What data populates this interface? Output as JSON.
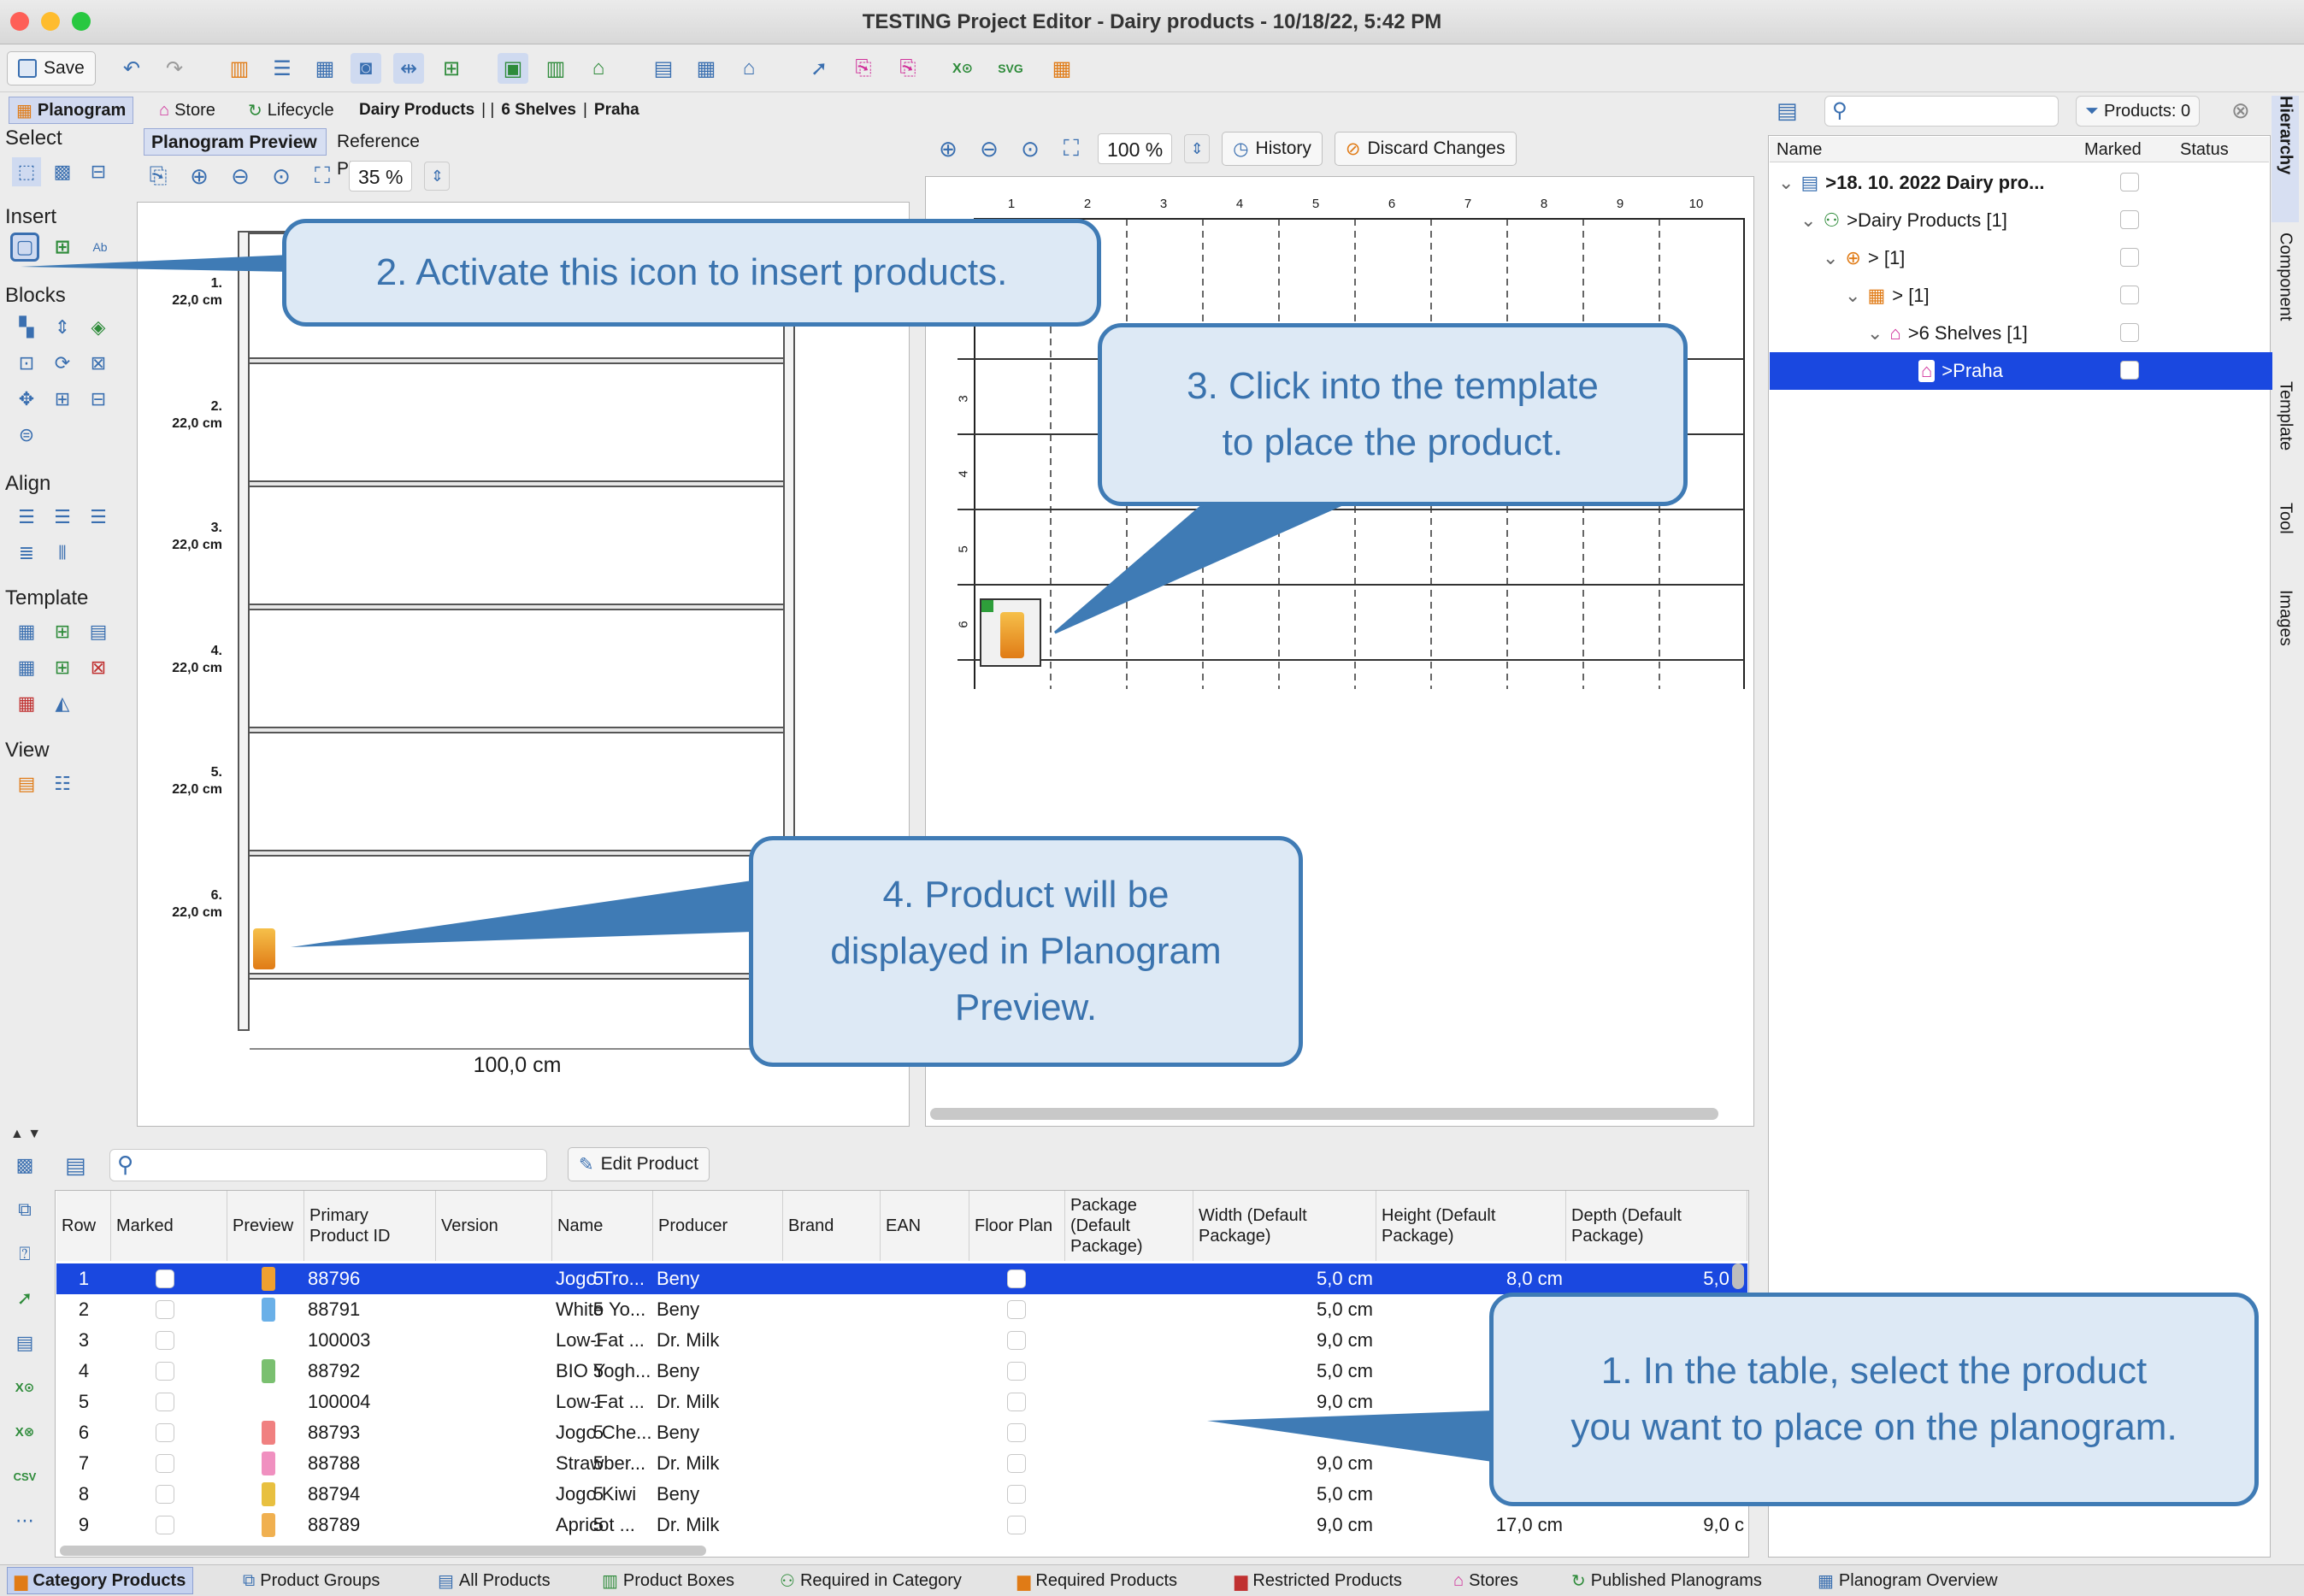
{
  "window": {
    "title": "TESTING Project Editor - Dairy products - 10/18/22, 5:42 PM"
  },
  "toolbar": {
    "save_label": "Save",
    "zoom_left": "35 %",
    "zoom_right": "100 %",
    "history_label": "History",
    "discard_label": "Discard Changes"
  },
  "context": {
    "tabs": [
      {
        "label": "Planogram"
      },
      {
        "label": "Store"
      },
      {
        "label": "Lifecycle"
      }
    ],
    "crumb_1": "Dairy Products",
    "crumb_sep": "| |",
    "crumb_2": "6 Shelves",
    "crumb_sep2": "|",
    "crumb_3": "Praha"
  },
  "palette": {
    "select": "Select",
    "insert": "Insert",
    "blocks": "Blocks",
    "align": "Align",
    "template": "Template",
    "view": "View"
  },
  "preview": {
    "tab_preview": "Planogram Preview",
    "tab_photos": "Reference Photos",
    "shelves": [
      {
        "n": "1.",
        "h": "22,0 cm"
      },
      {
        "n": "2.",
        "h": "22,0 cm"
      },
      {
        "n": "3.",
        "h": "22,0 cm"
      },
      {
        "n": "4.",
        "h": "22,0 cm"
      },
      {
        "n": "5.",
        "h": "22,0 cm"
      },
      {
        "n": "6.",
        "h": "22,0 cm"
      }
    ],
    "width_label": "100,0 cm"
  },
  "grid": {
    "cols": [
      "1",
      "2",
      "3",
      "4",
      "5",
      "6",
      "7",
      "8",
      "9",
      "10"
    ],
    "rows": [
      "2",
      "3",
      "4",
      "5",
      "6"
    ]
  },
  "hierarchy": {
    "products_label": "Products: 0",
    "col_name": "Name",
    "col_marked": "Marked",
    "col_status": "Status",
    "rows": [
      {
        "label": ">18. 10. 2022 Dairy pro..."
      },
      {
        "label": ">Dairy Products [1]"
      },
      {
        "label": "> [1]"
      },
      {
        "label": "> [1]"
      },
      {
        "label": ">6 Shelves [1]"
      },
      {
        "label": ">Praha"
      }
    ]
  },
  "side_tabs": {
    "hierarchy": "Hierarchy",
    "component": "Component",
    "template": "Template",
    "tool": "Tool",
    "images": "Images"
  },
  "table": {
    "edit_label": "Edit Product",
    "headers": {
      "row": "Row",
      "marked": "Marked",
      "preview": "Preview",
      "primary_1": "Primary",
      "primary_2": "Product ID",
      "version": "Version",
      "name": "Name",
      "producer": "Producer",
      "brand": "Brand",
      "ean": "EAN",
      "floor": "Floor Plan",
      "pkg_1": "Package",
      "pkg_2": "(Default",
      "pkg_3": "Package)",
      "w_1": "Width (Default",
      "w_2": "Package)",
      "h_1": "Height (Default",
      "h_2": "Package)",
      "d_1": "Depth (Default",
      "d_2": "Package)"
    },
    "rows": [
      {
        "row": "1",
        "pid": "88796",
        "ver": "5",
        "name": "Jogo Tro...",
        "prod": "Beny",
        "w": "5,0 cm",
        "h": "8,0 cm",
        "d": "5,0 c"
      },
      {
        "row": "2",
        "pid": "88791",
        "ver": "5",
        "name": "White Yo...",
        "prod": "Beny",
        "w": "5,0 cm",
        "h": "",
        "d": ""
      },
      {
        "row": "3",
        "pid": "100003",
        "ver": "1",
        "name": "Low-Fat ...",
        "prod": "Dr. Milk",
        "w": "9,0 cm",
        "h": "",
        "d": ""
      },
      {
        "row": "4",
        "pid": "88792",
        "ver": "5",
        "name": "BIO Yogh...",
        "prod": "Beny",
        "w": "5,0 cm",
        "h": "",
        "d": ""
      },
      {
        "row": "5",
        "pid": "100004",
        "ver": "1",
        "name": "Low-Fat ...",
        "prod": "Dr. Milk",
        "w": "9,0 cm",
        "h": "",
        "d": ""
      },
      {
        "row": "6",
        "pid": "88793",
        "ver": "5",
        "name": "Jogo Che...",
        "prod": "Beny",
        "w": "",
        "h": "",
        "d": ""
      },
      {
        "row": "7",
        "pid": "88788",
        "ver": "5",
        "name": "Strawber...",
        "prod": "Dr. Milk",
        "w": "9,0 cm",
        "h": "",
        "d": ""
      },
      {
        "row": "8",
        "pid": "88794",
        "ver": "5",
        "name": "Jogo Kiwi",
        "prod": "Beny",
        "w": "5,0 cm",
        "h": "",
        "d": ""
      },
      {
        "row": "9",
        "pid": "88789",
        "ver": "5",
        "name": "Apricot ...",
        "prod": "Dr. Milk",
        "w": "9,0 cm",
        "h": "17,0 cm",
        "d": "9,0 c"
      }
    ]
  },
  "bottom_tabs": [
    {
      "label": "Category Products"
    },
    {
      "label": "Product Groups"
    },
    {
      "label": "All Products"
    },
    {
      "label": "Product Boxes"
    },
    {
      "label": "Required in Category"
    },
    {
      "label": "Required Products"
    },
    {
      "label": "Restricted Products"
    },
    {
      "label": "Stores"
    },
    {
      "label": "Published Planograms"
    },
    {
      "label": "Planogram Overview"
    }
  ],
  "callouts": {
    "c1_a": "1. In the table, select the product",
    "c1_b": "you want to place on the planogram.",
    "c2": "2. Activate this icon to insert products.",
    "c3_a": "3. Click into the template",
    "c3_b": "to place the product.",
    "c4_a": "4. Product will be",
    "c4_b": "displayed in Planogram",
    "c4_c": "Preview."
  },
  "colors": {
    "accent": "#1a48e0",
    "callout_border": "#3f7bb5",
    "callout_fill": "#dde9f5"
  }
}
